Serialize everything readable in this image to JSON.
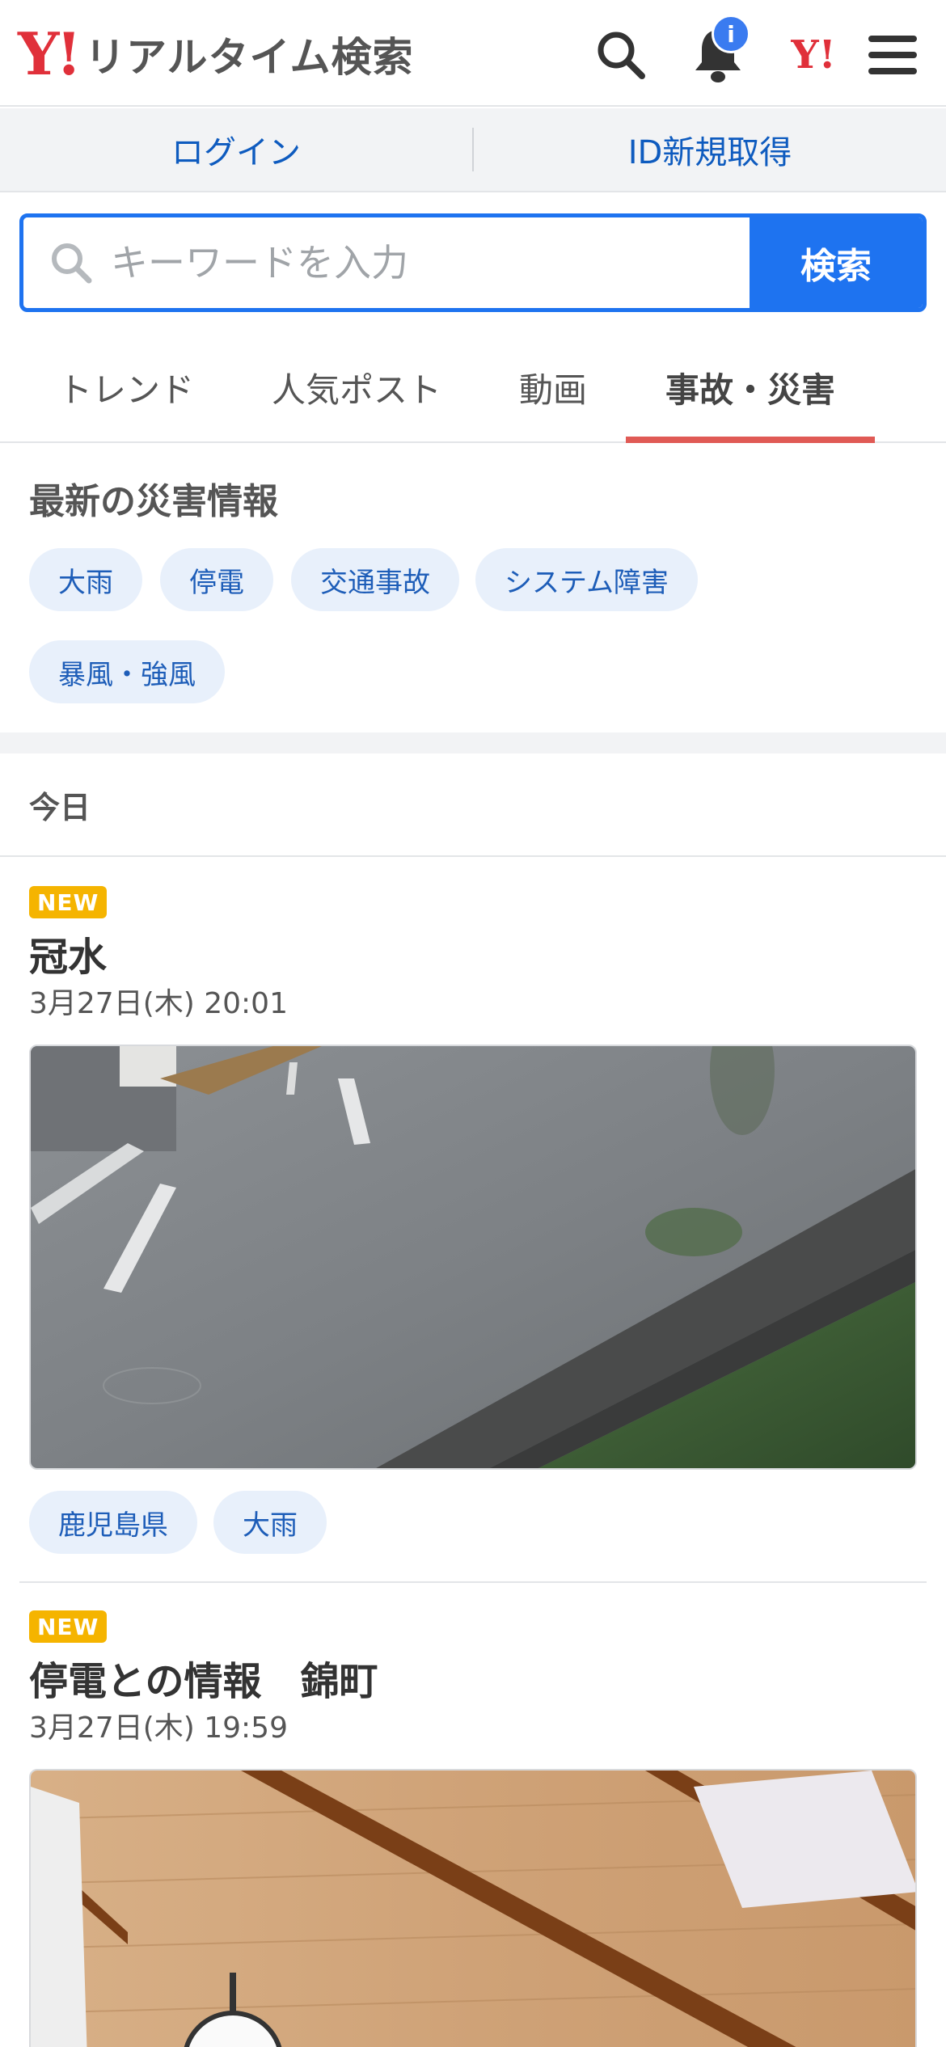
{
  "header": {
    "logo_mark": "Y!",
    "logo_text": "リアルタイム検索",
    "notification_badge": "i",
    "yahoo_small_logo": "Y!",
    "icons": [
      "search-icon",
      "bell-icon",
      "yahoo-logo-icon",
      "hamburger-menu-icon"
    ]
  },
  "login_bar": {
    "login_label": "ログイン",
    "register_label": "ID新規取得"
  },
  "search": {
    "placeholder": "キーワードを入力",
    "value": "",
    "button_label": "検索"
  },
  "tabs": [
    {
      "label": "トレンド",
      "active": false
    },
    {
      "label": "人気ポスト",
      "active": false
    },
    {
      "label": "動画",
      "active": false
    },
    {
      "label": "事故・災害",
      "active": true
    }
  ],
  "disaster": {
    "title": "最新の災害情報",
    "chips": [
      "大雨",
      "停電",
      "交通事故",
      "システム障害",
      "暴風・強風"
    ]
  },
  "section_label": "今日",
  "posts": [
    {
      "badge": "NEW",
      "title": "冠水",
      "date": "3月27日(木) 20:01",
      "tags": [
        "鹿児島県",
        "大雨"
      ]
    },
    {
      "badge": "NEW",
      "title": "停電との情報　錦町",
      "date": "3月27日(木) 19:59",
      "tags": []
    }
  ],
  "colors": {
    "brand_red": "#e0303a",
    "accent_blue": "#1e73f0",
    "link_blue": "#0e5bbf",
    "tab_underline": "#e05a55",
    "new_badge": "#f5b400",
    "chip_bg": "#e8f0fb",
    "notification_badge": "#3a7bf0"
  }
}
